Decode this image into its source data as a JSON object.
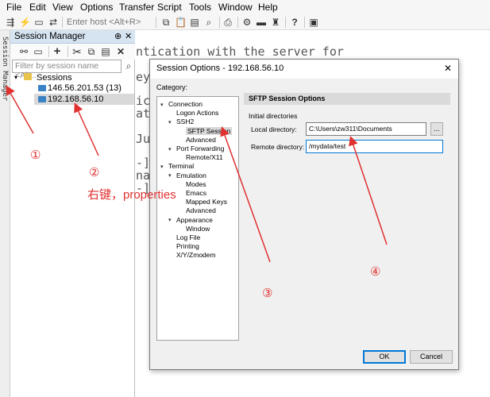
{
  "menubar": {
    "items": [
      "File",
      "Edit",
      "View",
      "Options",
      "Transfer",
      "Script",
      "Tools",
      "Window",
      "Help"
    ]
  },
  "toolbar": {
    "host_placeholder": "Enter host <Alt+R>"
  },
  "side_tab": {
    "label": "Session Manager"
  },
  "session_manager": {
    "title": "Session Manager",
    "pin": "⊕",
    "close": "✕",
    "filter_placeholder": "Filter by session name <Alt...",
    "tree": {
      "root": "Sessions",
      "items": [
        "146.56.201.53 (13)",
        "192.168.56.10"
      ]
    }
  },
  "terminal": {
    "lines": [
      "ntication with the server for",
      "ey",
      "ic",
      "at",
      "Ju",
      "-]$",
      "na",
      "-]$"
    ]
  },
  "dialog": {
    "title": "Session Options - 192.168.56.10",
    "close": "✕",
    "category_label": "Category:",
    "categories": [
      {
        "label": "Connection",
        "level": 0,
        "expanded": true
      },
      {
        "label": "Logon Actions",
        "level": 1
      },
      {
        "label": "SSH2",
        "level": 1,
        "expanded": true
      },
      {
        "label": "SFTP Session",
        "level": 2,
        "selected": true
      },
      {
        "label": "Advanced",
        "level": 2
      },
      {
        "label": "Port Forwarding",
        "level": 1,
        "expanded": true
      },
      {
        "label": "Remote/X11",
        "level": 2
      },
      {
        "label": "Terminal",
        "level": 0,
        "expanded": true
      },
      {
        "label": "Emulation",
        "level": 1,
        "expanded": true
      },
      {
        "label": "Modes",
        "level": 2
      },
      {
        "label": "Emacs",
        "level": 2
      },
      {
        "label": "Mapped Keys",
        "level": 2
      },
      {
        "label": "Advanced",
        "level": 2
      },
      {
        "label": "Appearance",
        "level": 1,
        "expanded": true
      },
      {
        "label": "Window",
        "level": 2
      },
      {
        "label": "Log File",
        "level": 1
      },
      {
        "label": "Printing",
        "level": 1
      },
      {
        "label": "X/Y/Zmodem",
        "level": 1
      }
    ],
    "panel": {
      "heading": "SFTP Session Options",
      "group": "Initial directories",
      "local_label": "Local directory:",
      "local_value": "C:\\Users\\zw311\\Documents",
      "browse": "...",
      "remote_label": "Remote directory:",
      "remote_value": "/mydata/test"
    },
    "ok": "OK",
    "cancel": "Cancel"
  },
  "annotations": {
    "n1": "①",
    "n2": "②",
    "n3": "③",
    "n4": "④",
    "note": "右键，properties",
    "color": "#e03030"
  }
}
